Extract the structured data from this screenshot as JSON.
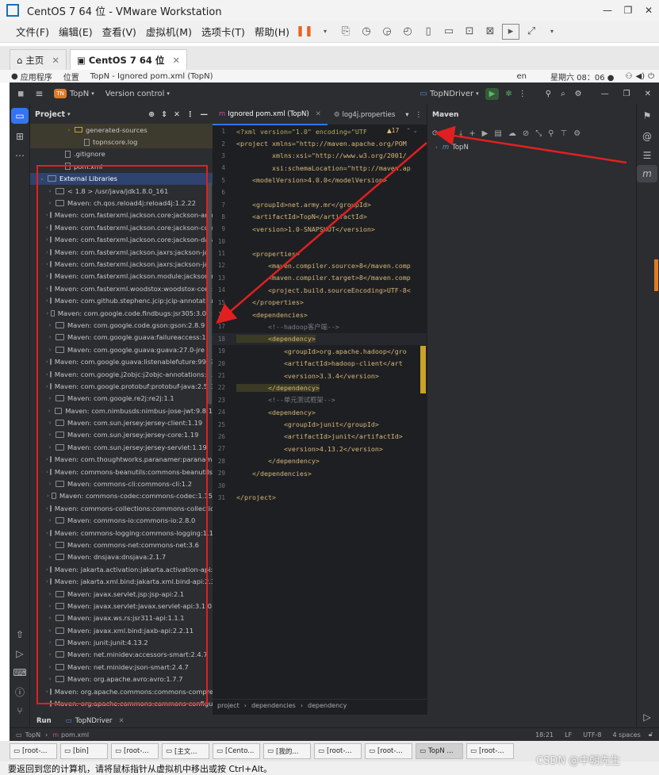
{
  "window": {
    "title": "CentOS 7 64 位 - VMware Workstation"
  },
  "menu": [
    "文件(F)",
    "编辑(E)",
    "查看(V)",
    "虚拟机(M)",
    "选项卡(T)",
    "帮助(H)"
  ],
  "vm_tabs": [
    {
      "label": "主页"
    },
    {
      "label": "CentOS 7 64 位"
    }
  ],
  "gnome": {
    "apps": "应用程序",
    "places": "位置",
    "active_window": "TopN - Ignored pom.xml (TopN)",
    "lang": "en",
    "clock": "星期六 08：06 ●"
  },
  "ide": {
    "project_badge": "TN",
    "project_name": "TopN",
    "vcs": "Version control",
    "run_config": "TopNDriver",
    "project_panel_title": "Project",
    "tree": [
      {
        "label": "generated-sources",
        "indent": 3,
        "type": "folder"
      },
      {
        "label": "topnscore.log",
        "indent": 4,
        "type": "file"
      },
      {
        "label": ".gitignore",
        "indent": 2,
        "type": "file"
      },
      {
        "label": "pom.xml",
        "indent": 2,
        "type": "file"
      },
      {
        "label": "External Libraries",
        "indent": 0,
        "type": "root"
      },
      {
        "label": "< 1.8 >  /usr/java/jdk1.8.0_161",
        "indent": 1,
        "type": "lib"
      },
      {
        "label": "Maven: ch.qos.reload4j:reload4j:1.2.22",
        "indent": 1,
        "type": "lib"
      },
      {
        "label": "Maven: com.fasterxml.jackson.core:jackson-annotati",
        "indent": 1,
        "type": "lib"
      },
      {
        "label": "Maven: com.fasterxml.jackson.core:jackson-core:2.1",
        "indent": 1,
        "type": "lib"
      },
      {
        "label": "Maven: com.fasterxml.jackson.core:jackson-databin",
        "indent": 1,
        "type": "lib"
      },
      {
        "label": "Maven: com.fasterxml.jackson.jaxrs:jackson-jaxrs-ba",
        "indent": 1,
        "type": "lib"
      },
      {
        "label": "Maven: com.fasterxml.jackson.jaxrs:jackson-jaxrs-js",
        "indent": 1,
        "type": "lib"
      },
      {
        "label": "Maven: com.fasterxml.jackson.module:jackson-modu",
        "indent": 1,
        "type": "lib"
      },
      {
        "label": "Maven: com.fasterxml.woodstox:woodstox-core:5.3",
        "indent": 1,
        "type": "lib"
      },
      {
        "label": "Maven: com.github.stephenc.jcip:jcip-annotations:1.0",
        "indent": 1,
        "type": "lib"
      },
      {
        "label": "Maven: com.google.code.findbugs:jsr305:3.0.2",
        "indent": 1,
        "type": "lib"
      },
      {
        "label": "Maven: com.google.code.gson:gson:2.8.9",
        "indent": 1,
        "type": "lib"
      },
      {
        "label": "Maven: com.google.guava:failureaccess:1.0",
        "indent": 1,
        "type": "lib"
      },
      {
        "label": "Maven: com.google.guava:guava:27.0-jre",
        "indent": 1,
        "type": "lib"
      },
      {
        "label": "Maven: com.google.guava:listenablefuture:9999.0-e",
        "indent": 1,
        "type": "lib"
      },
      {
        "label": "Maven: com.google.j2objc:j2objc-annotations:1.1",
        "indent": 1,
        "type": "lib"
      },
      {
        "label": "Maven: com.google.protobuf:protobuf-java:2.5.0",
        "indent": 1,
        "type": "lib"
      },
      {
        "label": "Maven: com.google.re2j:re2j:1.1",
        "indent": 1,
        "type": "lib"
      },
      {
        "label": "Maven: com.nimbusds:nimbus-jose-jwt:9.8.1",
        "indent": 1,
        "type": "lib"
      },
      {
        "label": "Maven: com.sun.jersey:jersey-client:1.19",
        "indent": 1,
        "type": "lib"
      },
      {
        "label": "Maven: com.sun.jersey:jersey-core:1.19",
        "indent": 1,
        "type": "lib"
      },
      {
        "label": "Maven: com.sun.jersey:jersey-servlet:1.19",
        "indent": 1,
        "type": "lib"
      },
      {
        "label": "Maven: com.thoughtworks.paranamer:paranamer:2",
        "indent": 1,
        "type": "lib"
      },
      {
        "label": "Maven: commons-beanutils:commons-beanutils:1.9",
        "indent": 1,
        "type": "lib"
      },
      {
        "label": "Maven: commons-cli:commons-cli:1.2",
        "indent": 1,
        "type": "lib"
      },
      {
        "label": "Maven: commons-codec:commons-codec:1.15",
        "indent": 1,
        "type": "lib"
      },
      {
        "label": "Maven: commons-collections:commons-collections",
        "indent": 1,
        "type": "lib"
      },
      {
        "label": "Maven: commons-io:commons-io:2.8.0",
        "indent": 1,
        "type": "lib"
      },
      {
        "label": "Maven: commons-logging:commons-logging:1.1.3",
        "indent": 1,
        "type": "lib"
      },
      {
        "label": "Maven: commons-net:commons-net:3.6",
        "indent": 1,
        "type": "lib"
      },
      {
        "label": "Maven: dnsjava:dnsjava:2.1.7",
        "indent": 1,
        "type": "lib"
      },
      {
        "label": "Maven: jakarta.activation:jakarta.activation-api:1.2.1",
        "indent": 1,
        "type": "lib"
      },
      {
        "label": "Maven: jakarta.xml.bind:jakarta.xml.bind-api:2.3.2",
        "indent": 1,
        "type": "lib"
      },
      {
        "label": "Maven: javax.servlet.jsp:jsp-api:2.1",
        "indent": 1,
        "type": "lib"
      },
      {
        "label": "Maven: javax.servlet:javax.servlet-api:3.1.0",
        "indent": 1,
        "type": "lib"
      },
      {
        "label": "Maven: javax.ws.rs:jsr311-api:1.1.1",
        "indent": 1,
        "type": "lib"
      },
      {
        "label": "Maven: javax.xml.bind:jaxb-api:2.2.11",
        "indent": 1,
        "type": "lib"
      },
      {
        "label": "Maven: junit:junit:4.13.2",
        "indent": 1,
        "type": "lib"
      },
      {
        "label": "Maven: net.minidev:accessors-smart:2.4.7",
        "indent": 1,
        "type": "lib"
      },
      {
        "label": "Maven: net.minidev:json-smart:2.4.7",
        "indent": 1,
        "type": "lib"
      },
      {
        "label": "Maven: org.apache.avro:avro:1.7.7",
        "indent": 1,
        "type": "lib"
      },
      {
        "label": "Maven: org.apache.commons:commons-compress:1",
        "indent": 1,
        "type": "lib"
      },
      {
        "label": "Maven: org.apache.commons:commons-configurati",
        "indent": 1,
        "type": "lib"
      }
    ],
    "editor_tabs": [
      {
        "label": "Ignored pom.xml (TopN)",
        "active": true
      },
      {
        "label": "log4j.properties",
        "active": false
      }
    ],
    "warning_count": "▲17",
    "code": [
      {
        "n": "1",
        "text": "<?xml version=\"1.0\" encoding=\"UTF"
      },
      {
        "n": "2",
        "text": "<project xmlns=\"http://maven.apache.org/POM"
      },
      {
        "n": "3",
        "text": "         xmlns:xsi=\"http://www.w3.org/2001/"
      },
      {
        "n": "4",
        "text": "         xsi:schemaLocation=\"http://maven.ap"
      },
      {
        "n": "5",
        "text": "    <modelVersion>4.0.0</modelVersion>"
      },
      {
        "n": "6",
        "text": ""
      },
      {
        "n": "7",
        "text": "    <groupId>net.army.mr</groupId>"
      },
      {
        "n": "8",
        "text": "    <artifactId>TopN</artifactId>"
      },
      {
        "n": "9",
        "text": "    <version>1.0-SNAPSHOT</version>"
      },
      {
        "n": "10",
        "text": ""
      },
      {
        "n": "11",
        "text": "    <properties>"
      },
      {
        "n": "12",
        "text": "        <maven.compiler.source>8</maven.comp"
      },
      {
        "n": "13",
        "text": "        <maven.compiler.target>8</maven.comp"
      },
      {
        "n": "14",
        "text": "        <project.build.sourceEncoding>UTF-8<"
      },
      {
        "n": "15",
        "text": "    </properties>"
      },
      {
        "n": "16",
        "text": "    <dependencies>"
      },
      {
        "n": "17",
        "text": "        <!--hadoop客户端-->"
      },
      {
        "n": "18",
        "text": "        <dependency>"
      },
      {
        "n": "19",
        "text": "            <groupId>org.apache.hadoop</gro"
      },
      {
        "n": "20",
        "text": "            <artifactId>hadoop-client</art"
      },
      {
        "n": "21",
        "text": "            <version>3.3.4</version>"
      },
      {
        "n": "22",
        "text": "        </dependency>"
      },
      {
        "n": "23",
        "text": "        <!--单元测试框架-->"
      },
      {
        "n": "24",
        "text": "        <dependency>"
      },
      {
        "n": "25",
        "text": "            <groupId>junit</groupId>"
      },
      {
        "n": "26",
        "text": "            <artifactId>junit</artifactId>"
      },
      {
        "n": "27",
        "text": "            <version>4.13.2</version>"
      },
      {
        "n": "28",
        "text": "        </dependency>"
      },
      {
        "n": "29",
        "text": "    </dependencies>"
      },
      {
        "n": "30",
        "text": ""
      },
      {
        "n": "31",
        "text": "</project>"
      }
    ],
    "breadcrumb": [
      "project",
      "dependencies",
      "dependency"
    ],
    "maven_title": "Maven",
    "maven_project": "TopN",
    "run_tab": "Run",
    "run_config_tab": "TopNDriver",
    "status_path": [
      "TopN",
      "pom.xml"
    ],
    "status_right": [
      "18:21",
      "LF",
      "UTF-8",
      "4 spaces"
    ]
  },
  "taskbar": [
    "[root-...",
    "[bin]",
    "[root-...",
    "[主文...",
    "[Cento...",
    "[我的...",
    "[root-...",
    "[root-...",
    "TopN ...",
    "[root-..."
  ],
  "message": "要返回到您的计算机，请将鼠标指针从虚拟机中移出或按 Ctrl+Alt。",
  "watermark": "CSDN @中朝先生",
  "colors": {
    "accent": "#3574f0",
    "annotation": "#e02020",
    "highlight_bar": "#c9a227"
  }
}
